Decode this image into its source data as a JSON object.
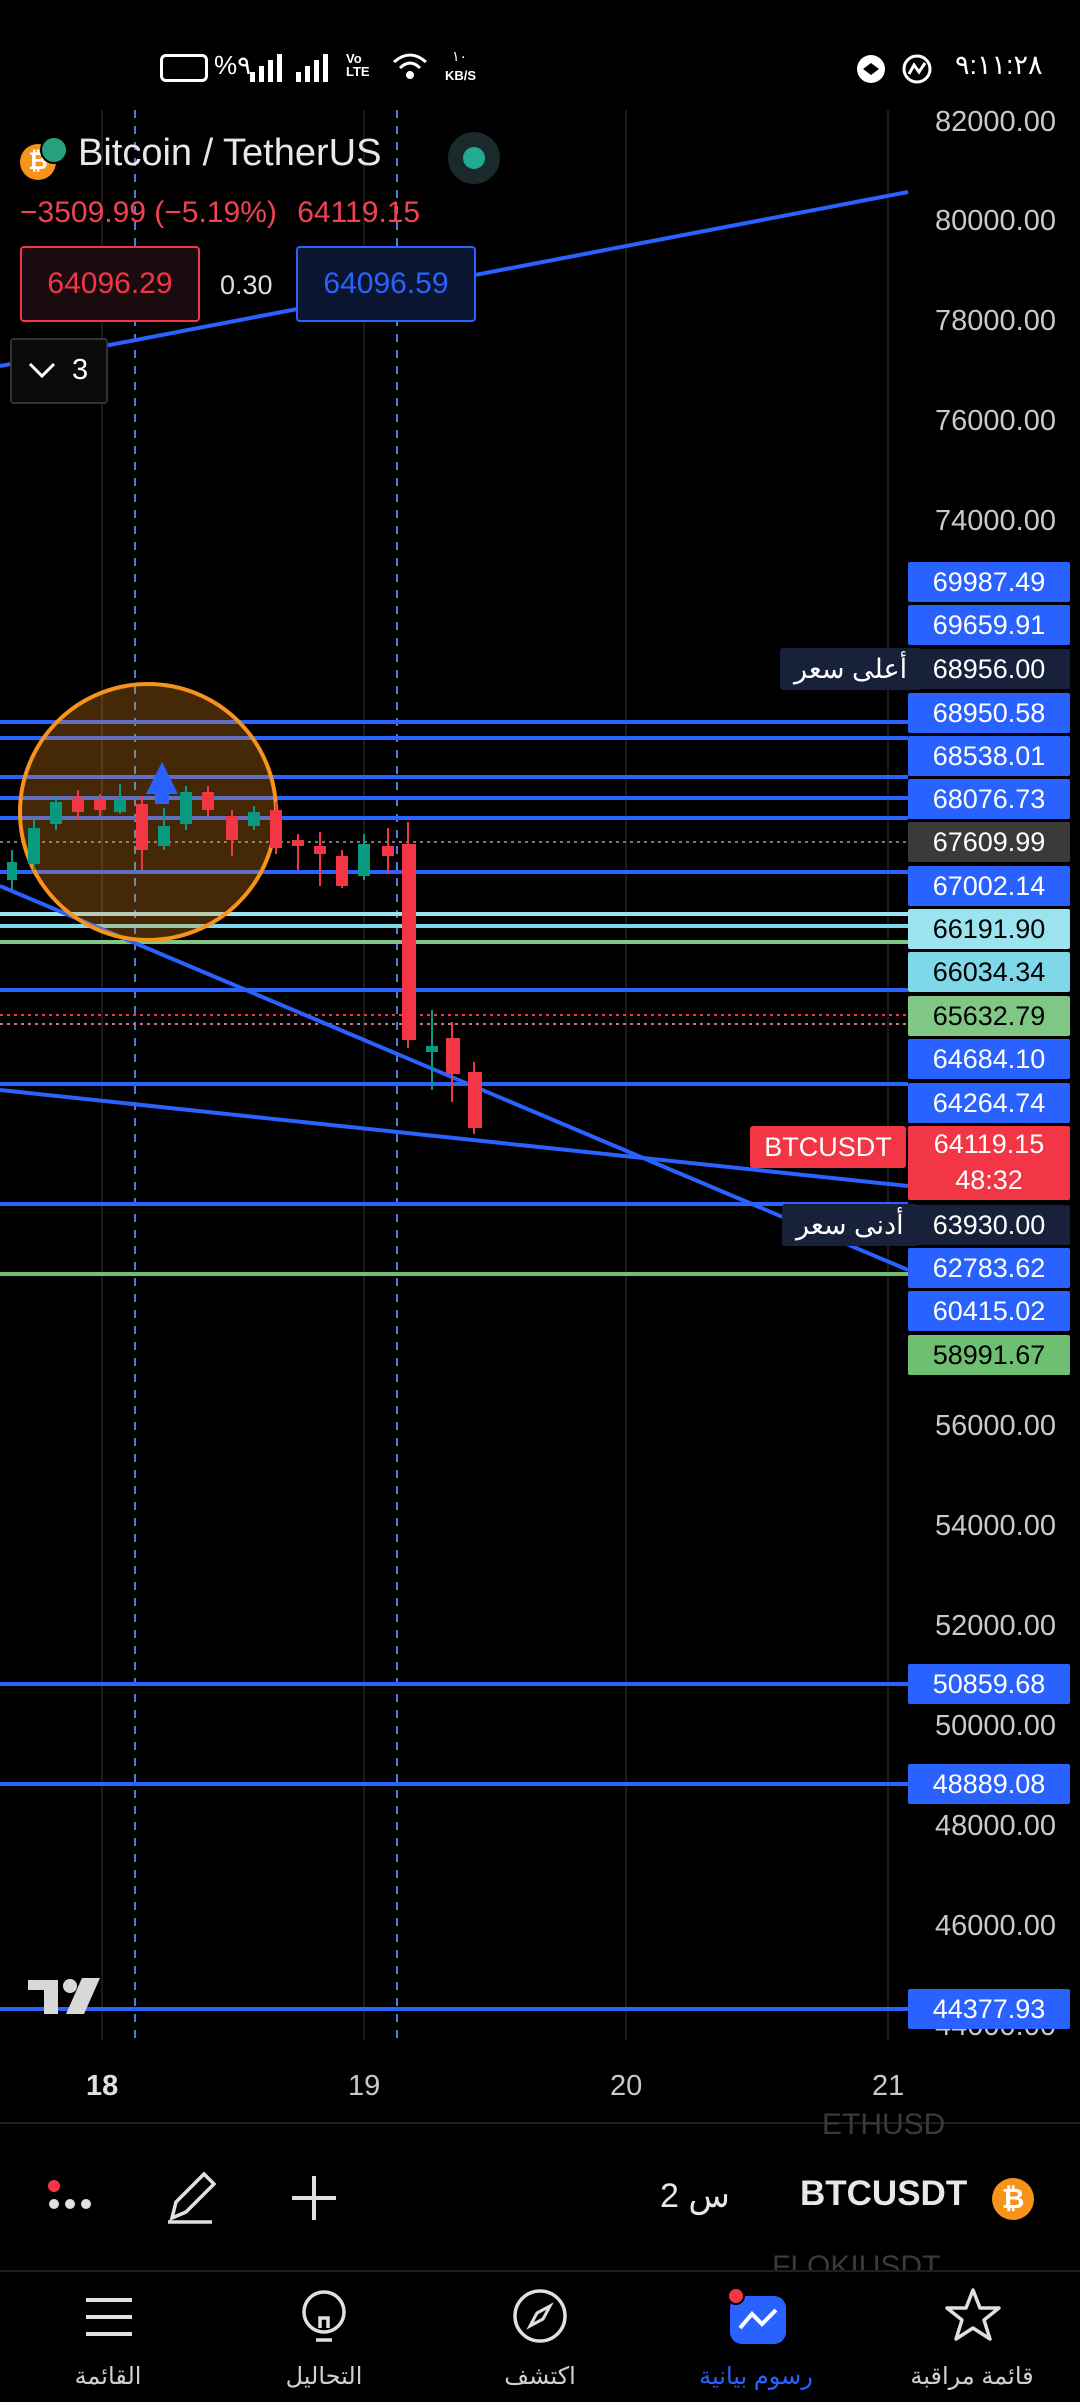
{
  "status_bar": {
    "time": "٩:١١:٢٨",
    "battery": "%٩",
    "net_speed_top": "١٠",
    "net_speed_unit": "KB/S",
    "volte": "Vo LTE"
  },
  "header": {
    "symbol_title": "Bitcoin / TetherUS",
    "change": "−3509.99 (−5.19%)",
    "last_price": "64119.15",
    "bid_price": "64096.29",
    "spread": "0.30",
    "ask_price": "64096.59",
    "collapse_count": "3"
  },
  "price_axis": [
    "82000.00",
    "80000.00",
    "78000.00",
    "76000.00",
    "74000.00",
    "56000.00",
    "54000.00",
    "52000.00",
    "50000.00",
    "48000.00",
    "46000.00",
    "44000.00"
  ],
  "level_tags": [
    {
      "value": "69987.49",
      "color": "#2962ff"
    },
    {
      "value": "69659.91",
      "color": "#2962ff"
    },
    {
      "value": "68956.00",
      "color": "#17223a"
    },
    {
      "value": "68950.58",
      "color": "#2962ff"
    },
    {
      "value": "68538.01",
      "color": "#2962ff"
    },
    {
      "value": "68076.73",
      "color": "#2962ff"
    },
    {
      "value": "67609.99",
      "color": "#3a3a3a"
    },
    {
      "value": "67002.14",
      "color": "#2962ff"
    },
    {
      "value": "66191.90",
      "color": "#9be3ee"
    },
    {
      "value": "66034.34",
      "color": "#7fd8e8"
    },
    {
      "value": "65632.79",
      "color": "#80c783"
    },
    {
      "value": "64684.10",
      "color": "#2962ff"
    },
    {
      "value": "64264.74",
      "color": "#2962ff"
    },
    {
      "value": "63930.00",
      "color": "#17223a"
    },
    {
      "value": "62783.62",
      "color": "#2962ff"
    },
    {
      "value": "60415.02",
      "color": "#2962ff"
    },
    {
      "value": "58991.67",
      "color": "#6fbf73"
    },
    {
      "value": "50859.68",
      "color": "#2962ff"
    },
    {
      "value": "48889.08",
      "color": "#2962ff"
    },
    {
      "value": "44377.93",
      "color": "#2962ff"
    }
  ],
  "current_price": {
    "symbol": "BTCUSDT",
    "price": "64119.15",
    "countdown": "48:32",
    "color": "#f23645"
  },
  "high_label": "أعلى سعر",
  "low_label": "أدنى سعر",
  "x_axis": [
    "18",
    "19",
    "20",
    "21"
  ],
  "toolbar": {
    "symbol": "BTCUSDT",
    "interval": "2 س",
    "scroll_top": "ETHUSD",
    "scroll_bottom": "FLOKIUSDT"
  },
  "tabs": [
    {
      "label": "قائمة مراقبة",
      "icon": "star-icon"
    },
    {
      "label": "رسوم بيانية",
      "icon": "chart-icon",
      "active": true
    },
    {
      "label": "اكتشف",
      "icon": "compass-icon"
    },
    {
      "label": "التحاليل",
      "icon": "lightbulb-icon"
    },
    {
      "label": "القائمة",
      "icon": "menu-icon"
    }
  ],
  "colors": {
    "accent": "#2962ff",
    "down": "#f23645",
    "up": "#089981",
    "orange": "#f7931a",
    "bg": "#000000"
  }
}
